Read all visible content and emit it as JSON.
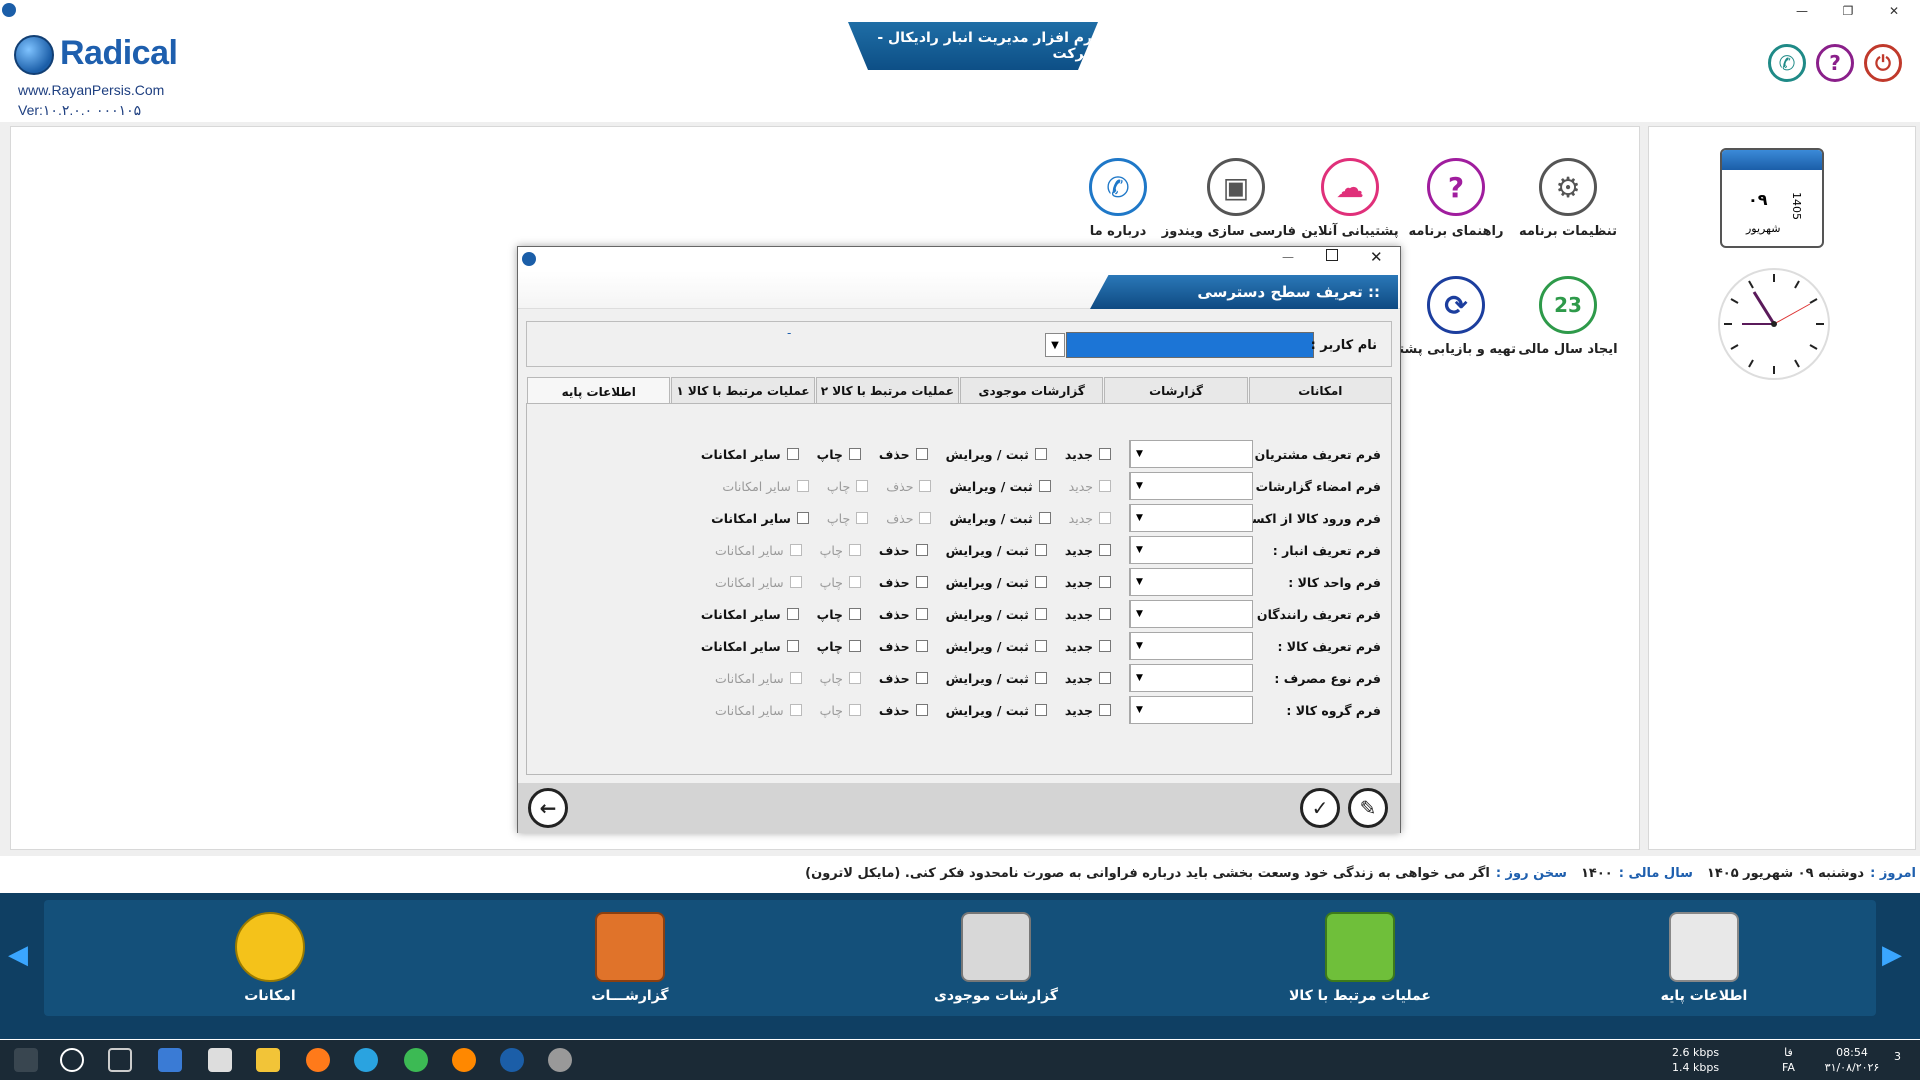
{
  "window": {
    "minimize": "—",
    "restore": "❐",
    "close": "✕"
  },
  "header": {
    "logo": "Radical",
    "website": "www.RayanPersis.Com",
    "version": "Ver:۱۰.۲.۰.۰   ۰۰۰۱۰۵",
    "app_title": "نرم افزار مدیریت انبار رادیکال - شرکت",
    "buttons": [
      {
        "name": "phone-icon",
        "glyph": "✆",
        "color": "#1f8a87"
      },
      {
        "name": "help-icon",
        "glyph": "?",
        "color": "#8a1f8a"
      },
      {
        "name": "exit-icon",
        "glyph": "⏻",
        "color": "#c0392b"
      }
    ]
  },
  "tiles": [
    {
      "label": "تنظیمات برنامه",
      "glyph": "⚙",
      "color": "#555555"
    },
    {
      "label": "راهنمای برنامه",
      "glyph": "?",
      "color": "#a01d9e"
    },
    {
      "label": "پشتیبانی آنلاین",
      "glyph": "☁",
      "color": "#e0307a"
    },
    {
      "label": "فارسی سازی ویندوز",
      "glyph": "▣",
      "color": "#555555"
    },
    {
      "label": "درباره ما",
      "glyph": "✆",
      "color": "#1f78c8"
    },
    {
      "label": "ایجاد سال مالی",
      "glyph": "23",
      "color": "#2e9a4a"
    },
    {
      "label": "تهیه و بازیابی پشتیبان",
      "glyph": "⟳",
      "color": "#1c3e9e"
    }
  ],
  "calendar": {
    "day": "۰۹",
    "month": "شهریور",
    "year": "1405"
  },
  "quote": {
    "today_label": "امروز :",
    "today_value": "دوشنبه ۰۹ شهریور ۱۴۰۵",
    "fiscal_label": "سال مالی :",
    "fiscal_value": "۱۴۰۰",
    "word_label": "سخن روز :",
    "word_value": "اگر می خواهی به زندگی خود وسعت بخشی باید درباره فراوانی به صورت نامحدود فکر کنی. (مایکل لاترون)"
  },
  "bottom": [
    {
      "label": "اطلاعات پایه",
      "color": "#e8e8e8"
    },
    {
      "label": "عملیات مرتبط با کالا",
      "color": "#6fbf3a"
    },
    {
      "label": "گزارشات موجودی",
      "color": "#d8d8d8"
    },
    {
      "label": "گزارشـــات",
      "color": "#e0732a"
    },
    {
      "label": "امکانات",
      "color": "#f4c21a"
    }
  ],
  "bottom_nav": {
    "left": "◀",
    "right": "▶"
  },
  "taskbar": {
    "speed_down": "2.6 kbps",
    "speed_up": "1.4 kbps",
    "lang1": "فا",
    "lang2": "FA",
    "time": "08:54",
    "date": "۳۱/۰۸/۲۰۲۶",
    "notif": "3"
  },
  "dialog": {
    "title": ":: تعریف سطح دسترسی",
    "user_label": "نام کاربر :",
    "user_dash": "-",
    "tabs": [
      "اطلاعات پایه",
      "عملیات مرتبط با کالا ۱",
      "عملیات مرتبط با کالا ۲",
      "گزارشات موجودی",
      "گزارشات",
      "امکانات"
    ],
    "checks": [
      "جدید",
      "ثبت / ویرایش",
      "حذف",
      "چاپ",
      "سایر امکانات"
    ],
    "forms": [
      {
        "label": "فرم تعریف مشتریان :",
        "enabled": [
          1,
          1,
          1,
          1,
          1
        ]
      },
      {
        "label": "فرم امضاء گزارشات :",
        "enabled": [
          0,
          1,
          0,
          0,
          0
        ]
      },
      {
        "label": "فرم ورود کالا از اکسل :",
        "enabled": [
          0,
          1,
          0,
          0,
          1
        ]
      },
      {
        "label": "فرم تعریف انبار :",
        "enabled": [
          1,
          1,
          1,
          0,
          0
        ]
      },
      {
        "label": "فرم واحد کالا :",
        "enabled": [
          1,
          1,
          1,
          0,
          0
        ]
      },
      {
        "label": "فرم تعریف رانندگان :",
        "enabled": [
          1,
          1,
          1,
          1,
          1
        ]
      },
      {
        "label": "فرم تعریف کالا :",
        "enabled": [
          1,
          1,
          1,
          1,
          1
        ]
      },
      {
        "label": "فرم نوع مصرف :",
        "enabled": [
          1,
          1,
          1,
          0,
          0
        ]
      },
      {
        "label": "فرم گروه کالا :",
        "enabled": [
          1,
          1,
          1,
          0,
          0
        ]
      }
    ],
    "footer": {
      "back": "←",
      "confirm": "✓",
      "edit": "✎"
    }
  }
}
